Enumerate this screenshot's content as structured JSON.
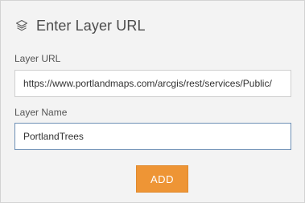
{
  "dialog": {
    "title": "Enter Layer URL",
    "title_icon": "layers-icon"
  },
  "form": {
    "layer_url_label": "Layer URL",
    "layer_url_value": "https://www.portlandmaps.com/arcgis/rest/services/Public/",
    "layer_name_label": "Layer Name",
    "layer_name_value": "PortlandTrees"
  },
  "actions": {
    "add_label": "ADD"
  },
  "colors": {
    "panel_background": "#f3f3f3",
    "accent": "#ee9535",
    "focused_border": "#6e8fb5"
  }
}
